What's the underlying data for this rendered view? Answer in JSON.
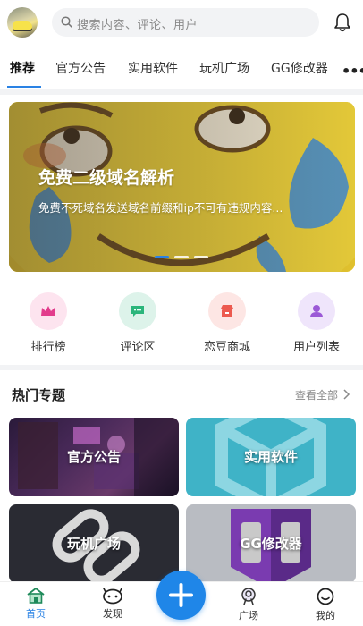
{
  "search": {
    "placeholder": "搜索内容、评论、用户"
  },
  "tabs": [
    {
      "label": "推荐"
    },
    {
      "label": "官方公告"
    },
    {
      "label": "实用软件"
    },
    {
      "label": "玩机广场"
    },
    {
      "label": "GG修改器"
    }
  ],
  "more_label": "•••",
  "banner": {
    "title": "免费二级域名解析",
    "subtitle": "免费不死域名发送域名前缀和ip不可有违规内容...",
    "slide_count": 3,
    "active_slide": 1
  },
  "quick": [
    {
      "label": "排行榜",
      "icon": "crown-icon",
      "color": "#fde4ef",
      "icon_color": "#e23c8c"
    },
    {
      "label": "评论区",
      "icon": "comment-icon",
      "color": "#ddf3ea",
      "icon_color": "#2bb57b"
    },
    {
      "label": "恋豆商城",
      "icon": "shop-icon",
      "color": "#fde6e4",
      "icon_color": "#ec5a4f"
    },
    {
      "label": "用户列表",
      "icon": "user-icon",
      "color": "#efe5fb",
      "icon_color": "#9b59d6"
    }
  ],
  "section": {
    "title": "热门专题",
    "see_all": "查看全部"
  },
  "topics": [
    {
      "label": "官方公告"
    },
    {
      "label": "实用软件"
    },
    {
      "label": "玩机广场"
    },
    {
      "label": "GG修改器"
    }
  ],
  "nav": [
    {
      "label": "首页"
    },
    {
      "label": "发现"
    },
    {
      "label": "广场"
    },
    {
      "label": "我的"
    }
  ],
  "colors": {
    "accent": "#2a82e4",
    "fab": "#1f86e8"
  }
}
